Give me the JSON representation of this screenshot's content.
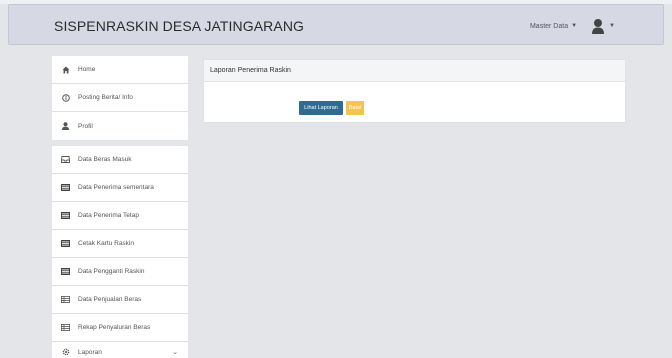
{
  "app": {
    "title": "SISPENRASKIN DESA JATINGARANG"
  },
  "nav": {
    "master_menu": "Master Data",
    "user_icon": "user-icon"
  },
  "sidebar": {
    "groups": [
      {
        "items": [
          {
            "label": "Home",
            "icon": "home-icon"
          },
          {
            "label": "Posting Berita/ Info",
            "icon": "info-icon"
          },
          {
            "label": "Profil",
            "icon": "user-icon"
          }
        ]
      },
      {
        "items": [
          {
            "label": "Data Beras Masuk",
            "icon": "inbox-icon"
          },
          {
            "label": "Data Penerima sementara",
            "icon": "list-icon"
          },
          {
            "label": "Data Penerima Tetap",
            "icon": "list-icon"
          },
          {
            "label": "Cetak Kartu Raskin",
            "icon": "list-icon"
          },
          {
            "label": "Data Pengganti Raskin",
            "icon": "list-icon"
          },
          {
            "label": "Data Penjualan Beras",
            "icon": "table-icon"
          },
          {
            "label": "Rekap Penyaluran Beras",
            "icon": "table-icon"
          },
          {
            "label": "Laporan",
            "icon": "gear-icon"
          }
        ]
      }
    ]
  },
  "panel": {
    "title": "Laporan Penerima Raskin",
    "primary_button": "Lihat Laporan",
    "secondary_button": "Batal"
  }
}
